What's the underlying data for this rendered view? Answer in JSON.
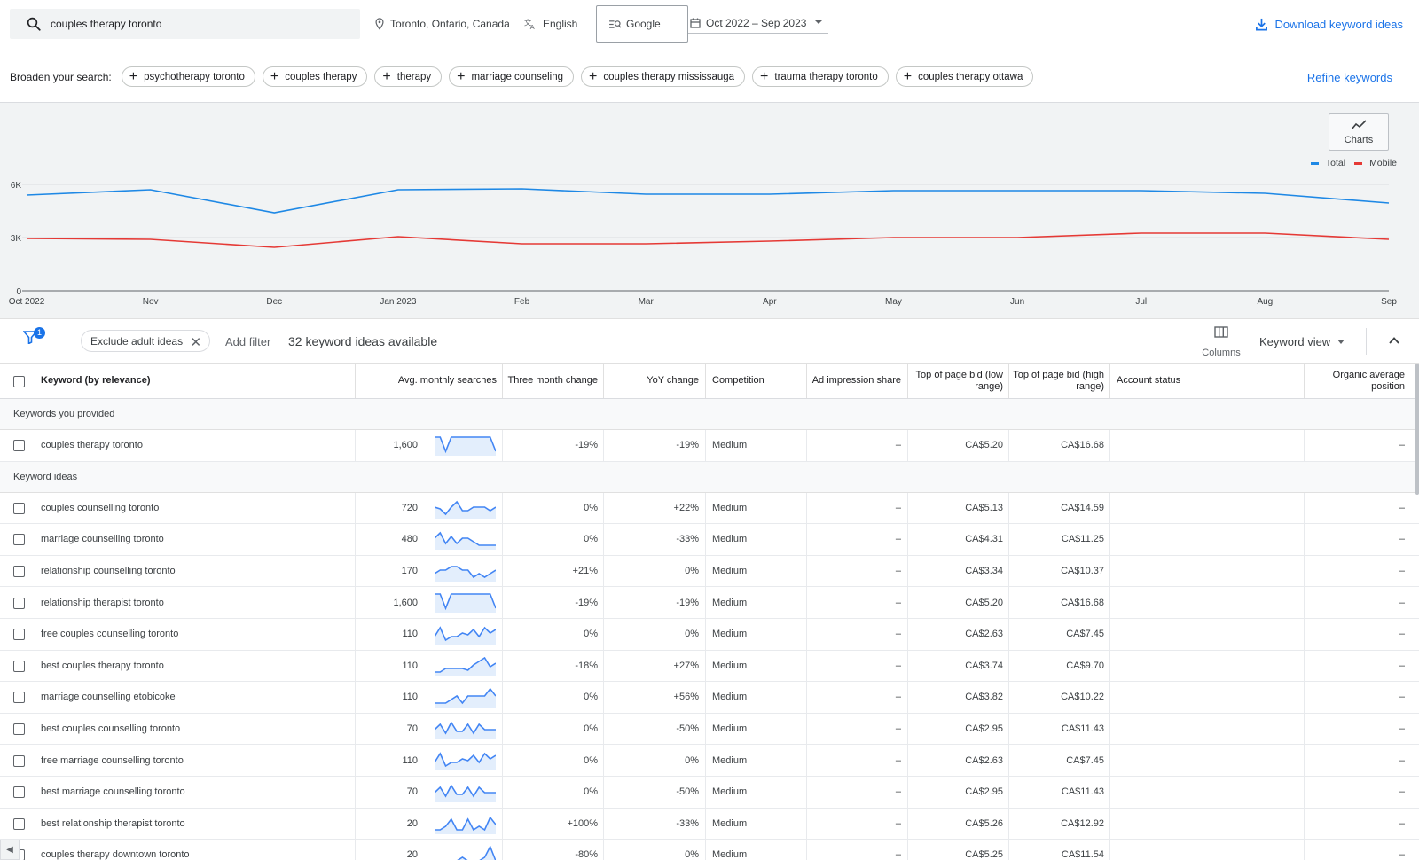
{
  "search": {
    "query": "couples therapy toronto"
  },
  "location": "Toronto, Ontario, Canada",
  "language": "English",
  "network": "Google",
  "date_range": "Oct 2022 – Sep 2023",
  "download_label": "Download keyword ideas",
  "broaden": {
    "label": "Broaden your search:",
    "chips": [
      "psychotherapy toronto",
      "couples therapy",
      "therapy",
      "marriage counseling",
      "couples therapy mississauga",
      "trauma therapy toronto",
      "couples therapy ottawa"
    ]
  },
  "refine_label": "Refine keywords",
  "charts_label": "Charts",
  "legend": {
    "total": "Total",
    "mobile": "Mobile",
    "total_color": "#1e88e5",
    "mobile_color": "#e53935"
  },
  "chart_data": {
    "type": "line",
    "x": [
      "Oct 2022",
      "Nov",
      "Dec",
      "Jan 2023",
      "Feb",
      "Mar",
      "Apr",
      "May",
      "Jun",
      "Jul",
      "Aug",
      "Sep"
    ],
    "y_ticks": [
      "0",
      "3K",
      "6K"
    ],
    "ylim": [
      0,
      6000
    ],
    "series": [
      {
        "name": "Total",
        "values": [
          5400,
          5700,
          4400,
          5700,
          5750,
          5450,
          5450,
          5650,
          5650,
          5650,
          5500,
          4950
        ]
      },
      {
        "name": "Mobile",
        "values": [
          2950,
          2900,
          2450,
          3050,
          2650,
          2650,
          2800,
          3000,
          3000,
          3250,
          3250,
          2900
        ]
      }
    ]
  },
  "filter": {
    "badge": "1",
    "exclude_label": "Exclude adult ideas",
    "add_filter": "Add filter",
    "count_text": "32 keyword ideas available"
  },
  "columns_label": "Columns",
  "keyword_view_label": "Keyword view",
  "table": {
    "headers": {
      "keyword": "Keyword (by relevance)",
      "searches": "Avg. monthly searches",
      "three_month": "Three month change",
      "yoy": "YoY change",
      "competition": "Competition",
      "impression": "Ad impression share",
      "bid_low": "Top of page bid (low range)",
      "bid_high": "Top of page bid (high range)",
      "account_status": "Account status",
      "organic": "Organic average position"
    },
    "provided_label": "Keywords you provided",
    "ideas_label": "Keyword ideas",
    "provided": [
      {
        "keyword": "couples therapy toronto",
        "searches": "1,600",
        "three_month": "-19%",
        "yoy": "-19%",
        "competition": "Medium",
        "impression": "–",
        "bid_low": "CA$5.20",
        "bid_high": "CA$16.68",
        "organic": "–",
        "trend": [
          10,
          10,
          2,
          10,
          10,
          10,
          10,
          10,
          10,
          10,
          10,
          2
        ]
      }
    ],
    "ideas": [
      {
        "keyword": "couples counselling toronto",
        "searches": "720",
        "three_month": "0%",
        "yoy": "+22%",
        "competition": "Medium",
        "impression": "–",
        "bid_low": "CA$5.13",
        "bid_high": "CA$14.59",
        "organic": "–",
        "trend": [
          6,
          5,
          2,
          6,
          9,
          4,
          4,
          6,
          6,
          6,
          4,
          6
        ]
      },
      {
        "keyword": "marriage counselling toronto",
        "searches": "480",
        "three_month": "0%",
        "yoy": "-33%",
        "competition": "Medium",
        "impression": "–",
        "bid_low": "CA$4.31",
        "bid_high": "CA$11.25",
        "organic": "–",
        "trend": [
          6,
          9,
          3,
          7,
          3,
          6,
          6,
          4,
          2,
          2,
          2,
          2
        ]
      },
      {
        "keyword": "relationship counselling toronto",
        "searches": "170",
        "three_month": "+21%",
        "yoy": "0%",
        "competition": "Medium",
        "impression": "–",
        "bid_low": "CA$3.34",
        "bid_high": "CA$10.37",
        "organic": "–",
        "trend": [
          4,
          6,
          6,
          8,
          8,
          6,
          6,
          2,
          4,
          2,
          4,
          6
        ]
      },
      {
        "keyword": "relationship therapist toronto",
        "searches": "1,600",
        "three_month": "-19%",
        "yoy": "-19%",
        "competition": "Medium",
        "impression": "–",
        "bid_low": "CA$5.20",
        "bid_high": "CA$16.68",
        "organic": "–",
        "trend": [
          10,
          10,
          2,
          10,
          10,
          10,
          10,
          10,
          10,
          10,
          10,
          2
        ]
      },
      {
        "keyword": "free couples counselling toronto",
        "searches": "110",
        "three_month": "0%",
        "yoy": "0%",
        "competition": "Medium",
        "impression": "–",
        "bid_low": "CA$2.63",
        "bid_high": "CA$7.45",
        "organic": "–",
        "trend": [
          4,
          9,
          2,
          4,
          4,
          6,
          5,
          8,
          4,
          9,
          6,
          8
        ]
      },
      {
        "keyword": "best couples therapy toronto",
        "searches": "110",
        "three_month": "-18%",
        "yoy": "+27%",
        "competition": "Medium",
        "impression": "–",
        "bid_low": "CA$3.74",
        "bid_high": "CA$9.70",
        "organic": "–",
        "trend": [
          2,
          2,
          4,
          4,
          4,
          4,
          3,
          6,
          8,
          10,
          5,
          7
        ]
      },
      {
        "keyword": "marriage counselling etobicoke",
        "searches": "110",
        "three_month": "0%",
        "yoy": "+56%",
        "competition": "Medium",
        "impression": "–",
        "bid_low": "CA$3.82",
        "bid_high": "CA$10.22",
        "organic": "–",
        "trend": [
          2,
          2,
          2,
          4,
          6,
          2,
          6,
          6,
          6,
          6,
          10,
          6
        ]
      },
      {
        "keyword": "best couples counselling toronto",
        "searches": "70",
        "three_month": "0%",
        "yoy": "-50%",
        "competition": "Medium",
        "impression": "–",
        "bid_low": "CA$2.95",
        "bid_high": "CA$11.43",
        "organic": "–",
        "trend": [
          5,
          8,
          3,
          9,
          4,
          4,
          8,
          3,
          8,
          5,
          5,
          5
        ]
      },
      {
        "keyword": "free marriage counselling toronto",
        "searches": "110",
        "three_month": "0%",
        "yoy": "0%",
        "competition": "Medium",
        "impression": "–",
        "bid_low": "CA$2.63",
        "bid_high": "CA$7.45",
        "organic": "–",
        "trend": [
          4,
          9,
          2,
          4,
          4,
          6,
          5,
          8,
          4,
          9,
          6,
          8
        ]
      },
      {
        "keyword": "best marriage counselling toronto",
        "searches": "70",
        "three_month": "0%",
        "yoy": "-50%",
        "competition": "Medium",
        "impression": "–",
        "bid_low": "CA$2.95",
        "bid_high": "CA$11.43",
        "organic": "–",
        "trend": [
          5,
          8,
          3,
          9,
          4,
          4,
          8,
          3,
          8,
          5,
          5,
          5
        ]
      },
      {
        "keyword": "best relationship therapist toronto",
        "searches": "20",
        "three_month": "+100%",
        "yoy": "-33%",
        "competition": "Medium",
        "impression": "–",
        "bid_low": "CA$5.26",
        "bid_high": "CA$12.92",
        "organic": "–",
        "trend": [
          2,
          2,
          4,
          8,
          2,
          2,
          8,
          2,
          4,
          2,
          9,
          5
        ]
      },
      {
        "keyword": "couples therapy downtown toronto",
        "searches": "20",
        "three_month": "-80%",
        "yoy": "0%",
        "competition": "Medium",
        "impression": "–",
        "bid_low": "CA$5.25",
        "bid_high": "CA$11.54",
        "organic": "–",
        "trend": [
          2,
          2,
          2,
          2,
          2,
          4,
          2,
          2,
          2,
          4,
          10,
          2
        ]
      }
    ]
  }
}
